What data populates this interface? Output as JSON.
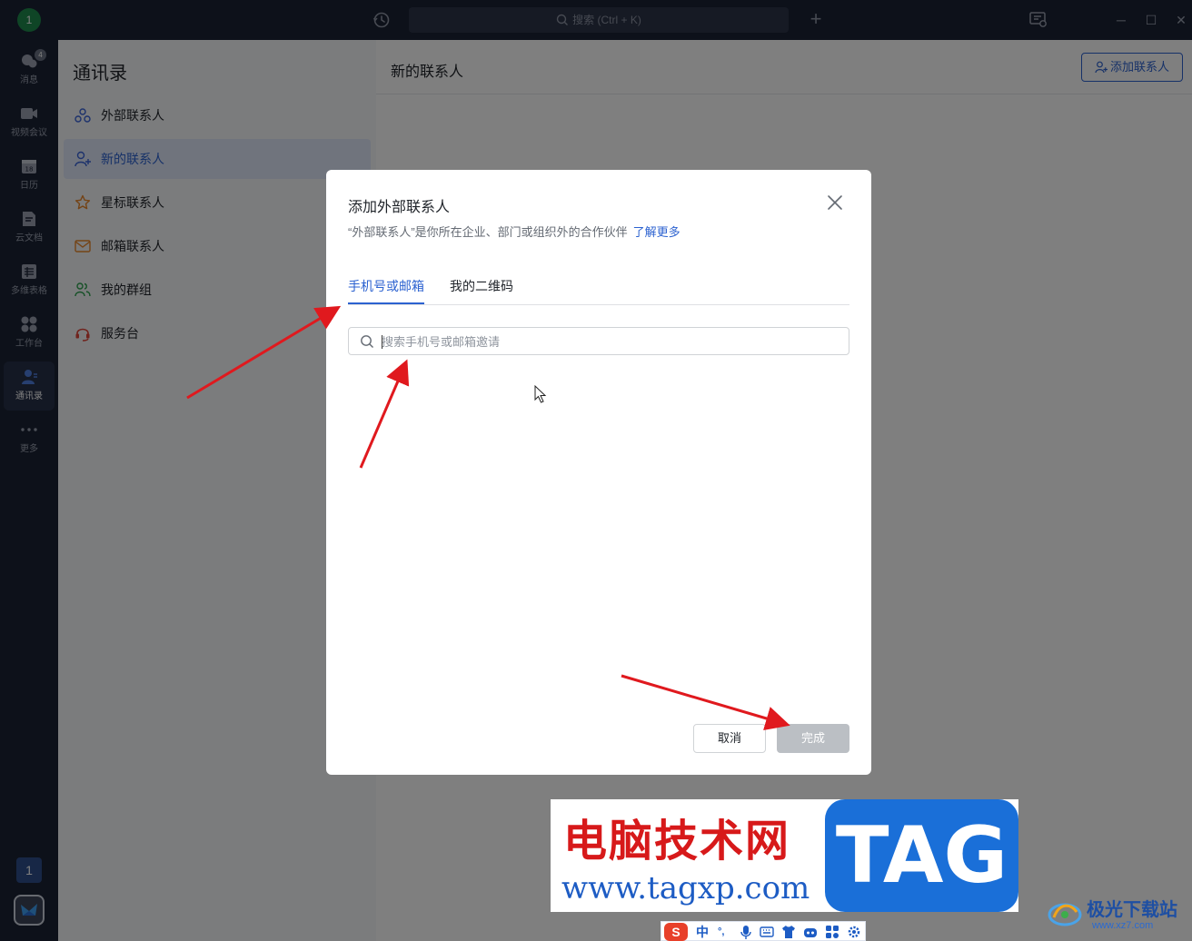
{
  "titlebar": {
    "user_initial": "1",
    "search_placeholder": "搜索 (Ctrl + K)",
    "add_symbol": "+",
    "minimize": "─",
    "maximize": "☐",
    "close": "✕"
  },
  "nav": {
    "items": [
      {
        "label": "消息",
        "icon": "chat-bubbles-icon",
        "badge": "4"
      },
      {
        "label": "视频会议",
        "icon": "video-camera-icon"
      },
      {
        "label": "日历",
        "icon": "calendar-icon",
        "date": "18"
      },
      {
        "label": "云文档",
        "icon": "cloud-doc-icon"
      },
      {
        "label": "多维表格",
        "icon": "table-icon"
      },
      {
        "label": "工作台",
        "icon": "grid-apps-icon"
      },
      {
        "label": "通讯录",
        "icon": "contacts-icon",
        "active": true
      },
      {
        "label": "更多",
        "icon": "more-dots-icon"
      }
    ],
    "page_number": "1"
  },
  "contacts": {
    "title": "通讯录",
    "items": [
      {
        "label": "外部联系人",
        "icon": "external-contacts-icon",
        "color": "#3a64d8"
      },
      {
        "label": "新的联系人",
        "icon": "add-contact-icon",
        "color": "#3a64d8",
        "active": true
      },
      {
        "label": "星标联系人",
        "icon": "star-icon",
        "color": "#e8872b"
      },
      {
        "label": "邮箱联系人",
        "icon": "mail-contact-icon",
        "color": "#e8872b"
      },
      {
        "label": "我的群组",
        "icon": "group-icon",
        "color": "#2ca24e"
      },
      {
        "label": "服务台",
        "icon": "headset-icon",
        "color": "#e0473a"
      }
    ]
  },
  "main": {
    "title": "新的联系人",
    "add_button": "添加联系人"
  },
  "dialog": {
    "title": "添加外部联系人",
    "description": "“外部联系人”是你所在企业、部门或组织外的合作伙伴",
    "learn_more": "了解更多",
    "tabs": [
      {
        "label": "手机号或邮箱",
        "active": true
      },
      {
        "label": "我的二维码"
      }
    ],
    "search_placeholder": "搜索手机号或邮箱邀请",
    "cancel": "取消",
    "done": "完成"
  },
  "watermark": {
    "cn_text": "电脑技术网",
    "url": "www.tagxp.com",
    "tag": "TAG",
    "site_name": "极光下载站",
    "site_url": "www.xz7.com"
  },
  "ime": {
    "logo": "S",
    "mode": "中",
    "punct": "°,"
  },
  "colors": {
    "accent": "#2c62d0",
    "sidebar_bg": "#1b2335",
    "arrow": "#e0191e"
  }
}
